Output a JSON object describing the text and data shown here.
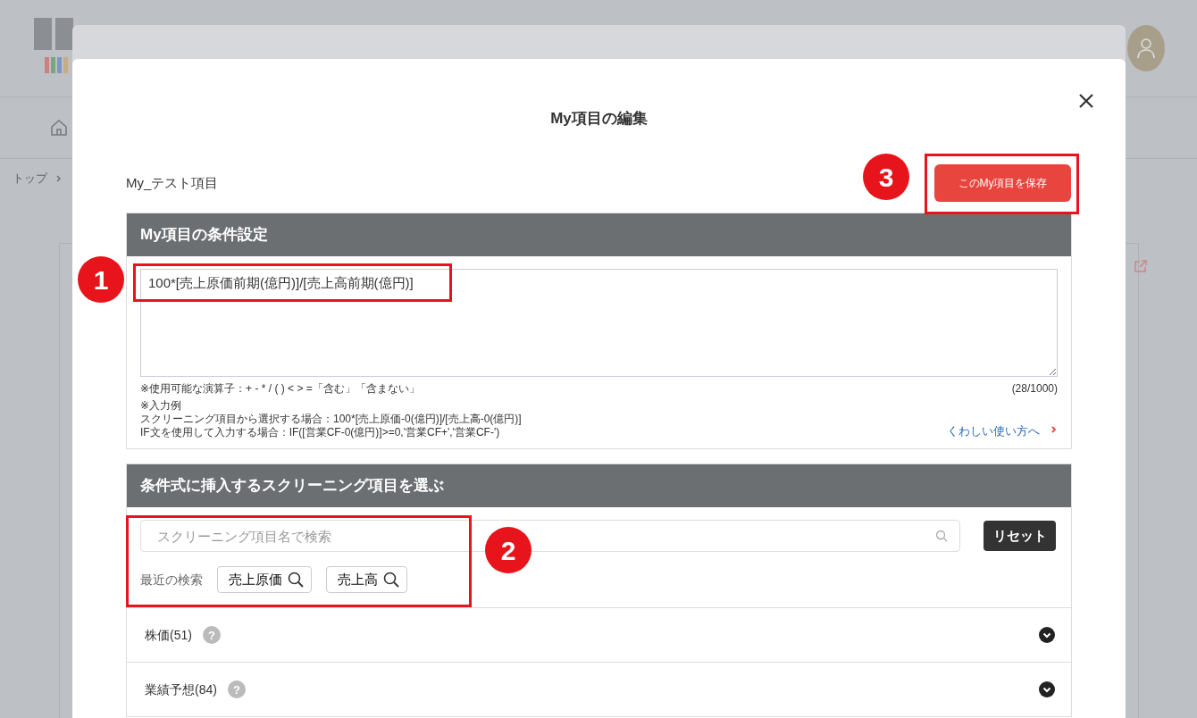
{
  "background_page": {
    "breadcrumb": [
      "トップ"
    ]
  },
  "modal": {
    "title": "My項目の編集",
    "item_name": "My_テスト項目",
    "save_button": "このMy項目を保存",
    "condition_section": {
      "heading": "My項目の条件設定",
      "formula": "100*[売上原価前期(億円)]/[売上高前期(億円)]",
      "operators_note": "※使用可能な演算子：+ - * / ( ) < > =「含む」「含まない」",
      "counter": "(28/1000)",
      "example_label": "※入力例",
      "examples": [
        "スクリーニング項目から選択する場合：100*[売上原価-0(億円)]/[売上高-0(億円)]",
        "IF文を使用して入力する場合：IF([営業CF-0(億円)]>=0,'営業CF+','営業CF-')"
      ],
      "help_link": "くわしい使い方へ"
    },
    "picker_section": {
      "heading": "条件式に挿入するスクリーニング項目を選ぶ",
      "search": {
        "placeholder": "スクリーニング項目名で検索"
      },
      "reset_button": "リセット",
      "recent_label": "最近の検索",
      "recent_searches": [
        "売上原価",
        "売上高"
      ],
      "categories": [
        {
          "label": "株価(51)",
          "help": "?",
          "expanded": false
        },
        {
          "label": "業績予想(84)",
          "help": "?",
          "expanded": false
        }
      ]
    }
  },
  "annotations": [
    {
      "number": "1"
    },
    {
      "number": "2"
    },
    {
      "number": "3"
    }
  ]
}
